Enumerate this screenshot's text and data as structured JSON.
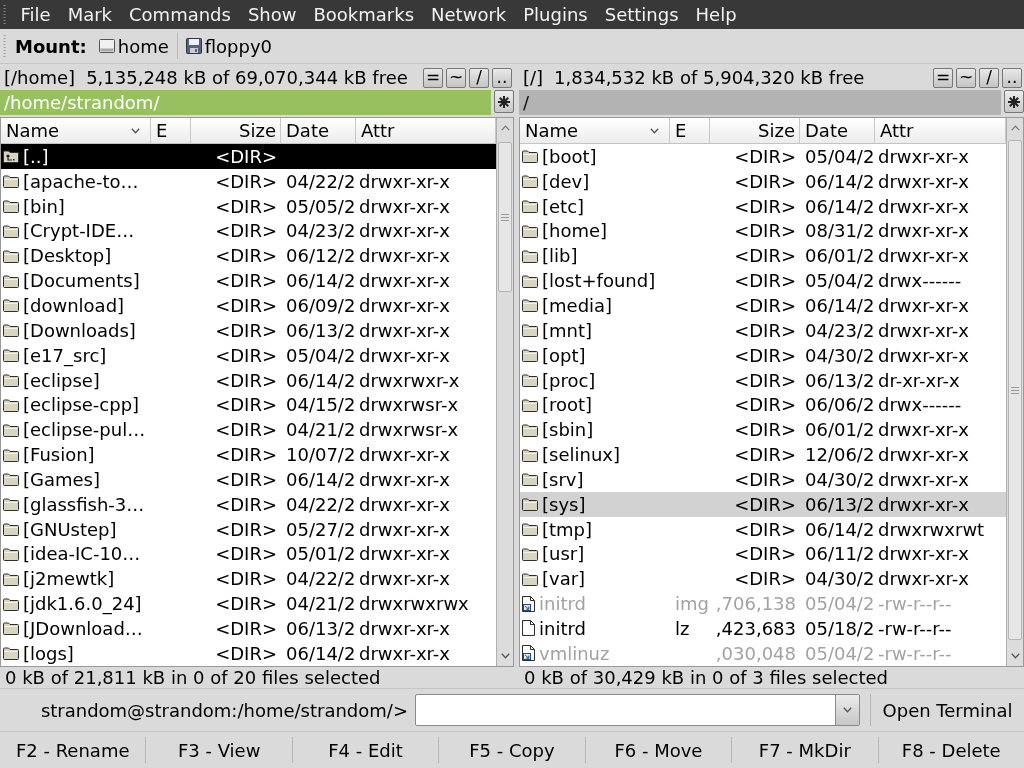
{
  "menu_bar": [
    {
      "label": "File"
    },
    {
      "label": "Mark"
    },
    {
      "label": "Commands"
    },
    {
      "label": "Show"
    },
    {
      "label": "Bookmarks"
    },
    {
      "label": "Network"
    },
    {
      "label": "Plugins"
    },
    {
      "label": "Settings"
    },
    {
      "label": "Help"
    }
  ],
  "mount_bar": {
    "label": "Mount:",
    "drives": [
      {
        "kind": "disk",
        "label": "home"
      },
      {
        "kind": "floppy",
        "label": "floppy0"
      }
    ]
  },
  "panels": [
    {
      "active": true,
      "drive": "[/home]",
      "free_space": "5,135,248 kB of 69,070,344 kB free",
      "nav_buttons": [
        "=",
        "~",
        "/",
        ".."
      ],
      "path": "/home/strandom/",
      "columns": [
        {
          "label": "Name",
          "sorted": true
        },
        {
          "label": "E",
          "sorted": false
        },
        {
          "label": "Size",
          "sorted": false
        },
        {
          "label": "Date",
          "sorted": false
        },
        {
          "label": "Attr",
          "sorted": false
        }
      ],
      "rows": [
        {
          "kind": "parent",
          "name": "[..]",
          "size": "<DIR>",
          "selected": true
        },
        {
          "kind": "folder",
          "name": "[apache-to…",
          "size": "<DIR>",
          "date": "04/22/2",
          "attr": "drwxr-xr-x",
          "selected": false
        },
        {
          "kind": "folder",
          "name": "[bin]",
          "size": "<DIR>",
          "date": "05/05/2",
          "attr": "drwxr-xr-x",
          "selected": false
        },
        {
          "kind": "folder",
          "name": "[Crypt-IDE…",
          "size": "<DIR>",
          "date": "04/23/2",
          "attr": "drwxr-xr-x",
          "selected": false
        },
        {
          "kind": "folder",
          "name": "[Desktop]",
          "size": "<DIR>",
          "date": "06/12/2",
          "attr": "drwxr-xr-x",
          "selected": false
        },
        {
          "kind": "folder",
          "name": "[Documents]",
          "size": "<DIR>",
          "date": "06/14/2",
          "attr": "drwxr-xr-x",
          "selected": false
        },
        {
          "kind": "folder",
          "name": "[download]",
          "size": "<DIR>",
          "date": "06/09/2",
          "attr": "drwxr-xr-x",
          "selected": false
        },
        {
          "kind": "folder",
          "name": "[Downloads]",
          "size": "<DIR>",
          "date": "06/13/2",
          "attr": "drwxr-xr-x",
          "selected": false
        },
        {
          "kind": "folder",
          "name": "[e17_src]",
          "size": "<DIR>",
          "date": "05/04/2",
          "attr": "drwxr-xr-x",
          "selected": false
        },
        {
          "kind": "folder",
          "name": "[eclipse]",
          "size": "<DIR>",
          "date": "06/14/2",
          "attr": "drwxrwxr-x",
          "selected": false
        },
        {
          "kind": "folder",
          "name": "[eclipse-cpp]",
          "size": "<DIR>",
          "date": "04/15/2",
          "attr": "drwxrwsr-x",
          "selected": false
        },
        {
          "kind": "folder",
          "name": "[eclipse-pul…",
          "size": "<DIR>",
          "date": "04/21/2",
          "attr": "drwxrwsr-x",
          "selected": false
        },
        {
          "kind": "folder",
          "name": "[Fusion]",
          "size": "<DIR>",
          "date": "10/07/2",
          "attr": "drwxr-xr-x",
          "selected": false
        },
        {
          "kind": "folder",
          "name": "[Games]",
          "size": "<DIR>",
          "date": "06/14/2",
          "attr": "drwxr-xr-x",
          "selected": false
        },
        {
          "kind": "folder",
          "name": "[glassfish-3…",
          "size": "<DIR>",
          "date": "04/22/2",
          "attr": "drwxr-xr-x",
          "selected": false
        },
        {
          "kind": "folder",
          "name": "[GNUstep]",
          "size": "<DIR>",
          "date": "05/27/2",
          "attr": "drwxr-xr-x",
          "selected": false
        },
        {
          "kind": "folder",
          "name": "[idea-IC-10…",
          "size": "<DIR>",
          "date": "05/01/2",
          "attr": "drwxr-xr-x",
          "selected": false
        },
        {
          "kind": "folder",
          "name": "[j2mewtk]",
          "size": "<DIR>",
          "date": "04/22/2",
          "attr": "drwxr-xr-x",
          "selected": false
        },
        {
          "kind": "folder",
          "name": "[jdk1.6.0_24]",
          "size": "<DIR>",
          "date": "04/21/2",
          "attr": "drwxrwxrwx",
          "selected": false
        },
        {
          "kind": "folder",
          "name": "[JDownload…",
          "size": "<DIR>",
          "date": "06/13/2",
          "attr": "drwxr-xr-x",
          "selected": false
        },
        {
          "kind": "folder",
          "name": "[logs]",
          "size": "<DIR>",
          "date": "06/14/2",
          "attr": "drwxr-xr-x",
          "selected": false
        }
      ],
      "status": "0 kB of 21,811 kB in 0 of 20 files selected"
    },
    {
      "active": false,
      "drive": "[/]",
      "free_space": "1,834,532 kB of 5,904,320 kB free",
      "nav_buttons": [
        "=",
        "~",
        "/",
        ".."
      ],
      "path": "/",
      "columns": [
        {
          "label": "Name",
          "sorted": true
        },
        {
          "label": "E",
          "sorted": false
        },
        {
          "label": "Size",
          "sorted": false
        },
        {
          "label": "Date",
          "sorted": false
        },
        {
          "label": "Attr",
          "sorted": false
        }
      ],
      "rows": [
        {
          "kind": "folder",
          "name": "[boot]",
          "size": "<DIR>",
          "date": "05/04/2",
          "attr": "drwxr-xr-x",
          "selected": false
        },
        {
          "kind": "folder",
          "name": "[dev]",
          "size": "<DIR>",
          "date": "06/14/2",
          "attr": "drwxr-xr-x",
          "selected": false
        },
        {
          "kind": "folder",
          "name": "[etc]",
          "size": "<DIR>",
          "date": "06/14/2",
          "attr": "drwxr-xr-x",
          "selected": false
        },
        {
          "kind": "folder",
          "name": "[home]",
          "size": "<DIR>",
          "date": "08/31/2",
          "attr": "drwxr-xr-x",
          "selected": false
        },
        {
          "kind": "folder",
          "name": "[lib]",
          "size": "<DIR>",
          "date": "06/01/2",
          "attr": "drwxr-xr-x",
          "selected": false
        },
        {
          "kind": "folder",
          "name": "[lost+found]",
          "size": "<DIR>",
          "date": "05/04/2",
          "attr": "drwx------",
          "selected": false
        },
        {
          "kind": "folder",
          "name": "[media]",
          "size": "<DIR>",
          "date": "06/14/2",
          "attr": "drwxr-xr-x",
          "selected": false
        },
        {
          "kind": "folder",
          "name": "[mnt]",
          "size": "<DIR>",
          "date": "04/23/2",
          "attr": "drwxr-xr-x",
          "selected": false
        },
        {
          "kind": "folder",
          "name": "[opt]",
          "size": "<DIR>",
          "date": "04/30/2",
          "attr": "drwxr-xr-x",
          "selected": false
        },
        {
          "kind": "folder",
          "name": "[proc]",
          "size": "<DIR>",
          "date": "06/13/2",
          "attr": "dr-xr-xr-x",
          "selected": false
        },
        {
          "kind": "folder",
          "name": "[root]",
          "size": "<DIR>",
          "date": "06/06/2",
          "attr": "drwx------",
          "selected": false
        },
        {
          "kind": "folder",
          "name": "[sbin]",
          "size": "<DIR>",
          "date": "06/01/2",
          "attr": "drwxr-xr-x",
          "selected": false
        },
        {
          "kind": "folder",
          "name": "[selinux]",
          "size": "<DIR>",
          "date": "12/06/2",
          "attr": "drwxr-xr-x",
          "selected": false
        },
        {
          "kind": "folder",
          "name": "[srv]",
          "size": "<DIR>",
          "date": "04/30/2",
          "attr": "drwxr-xr-x",
          "selected": false
        },
        {
          "kind": "folder",
          "name": "[sys]",
          "size": "<DIR>",
          "date": "06/13/2",
          "attr": "drwxr-xr-x",
          "selected": true
        },
        {
          "kind": "folder",
          "name": "[tmp]",
          "size": "<DIR>",
          "date": "06/14/2",
          "attr": "drwxrwxrwt",
          "selected": false
        },
        {
          "kind": "folder",
          "name": "[usr]",
          "size": "<DIR>",
          "date": "06/11/2",
          "attr": "drwxr-xr-x",
          "selected": false
        },
        {
          "kind": "folder",
          "name": "[var]",
          "size": "<DIR>",
          "date": "04/30/2",
          "attr": "drwxr-xr-x",
          "selected": false
        },
        {
          "kind": "link",
          "name": "initrd",
          "ext": "img",
          "size": ",706,138",
          "date": "05/04/2",
          "attr": "-rw-r--r--",
          "selected": false
        },
        {
          "kind": "file",
          "name": "initrd",
          "ext": "lz",
          "size": ",423,683",
          "date": "05/18/2",
          "attr": "-rw-r--r--",
          "selected": false
        },
        {
          "kind": "link",
          "name": "vmlinuz",
          "size": ",030,048",
          "date": "05/04/2",
          "attr": "-rw-r--r--",
          "selected": false
        }
      ],
      "status": "0 kB of 30,429 kB in 0 of 3 files selected"
    }
  ],
  "command_line": {
    "prompt": "strandom@strandom:/home/strandom/>",
    "open_terminal": "Open Terminal"
  },
  "function_keys": [
    "F2 - Rename",
    "F3 - View",
    "F4 - Edit",
    "F5 - Copy",
    "F6 - Move",
    "F7 - MkDir",
    "F8 - Delete"
  ]
}
